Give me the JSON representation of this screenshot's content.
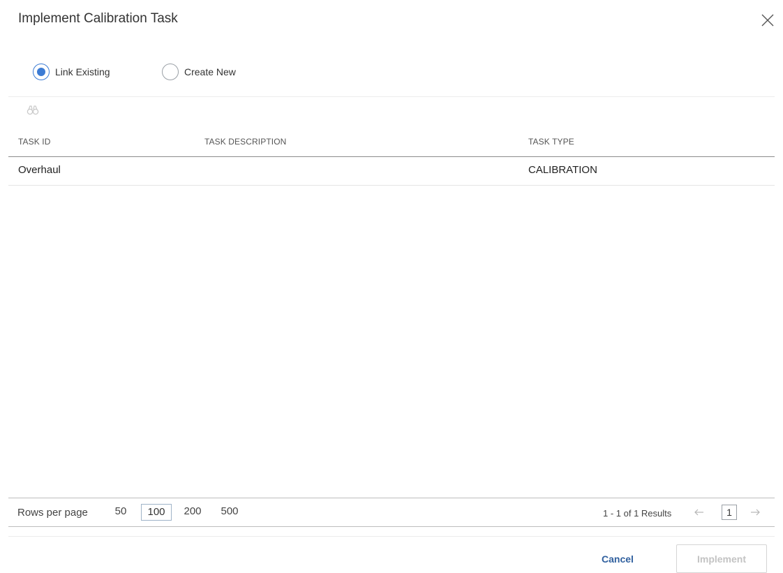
{
  "dialog": {
    "title": "Implement Calibration Task",
    "close_icon": "close-icon"
  },
  "mode": {
    "options": [
      {
        "label": "Link Existing",
        "selected": true
      },
      {
        "label": "Create New",
        "selected": false
      }
    ],
    "accent_color": "#3b7bd4"
  },
  "toolbar": {
    "search_icon": "binoculars-icon"
  },
  "table": {
    "columns": [
      "TASK ID",
      "TASK DESCRIPTION",
      "TASK TYPE"
    ],
    "rows": [
      {
        "task_id": "Overhaul",
        "task_description": "",
        "task_type": "CALIBRATION"
      }
    ]
  },
  "pagination": {
    "rows_per_page_label": "Rows per page",
    "page_sizes": [
      "50",
      "100",
      "200",
      "500"
    ],
    "selected_page_size": "100",
    "results_text": "1 - 1 of 1 Results",
    "current_page": "1",
    "prev_icon": "arrow-left-icon",
    "next_icon": "arrow-right-icon"
  },
  "actions": {
    "cancel_label": "Cancel",
    "implement_label": "Implement",
    "implement_disabled": true
  }
}
